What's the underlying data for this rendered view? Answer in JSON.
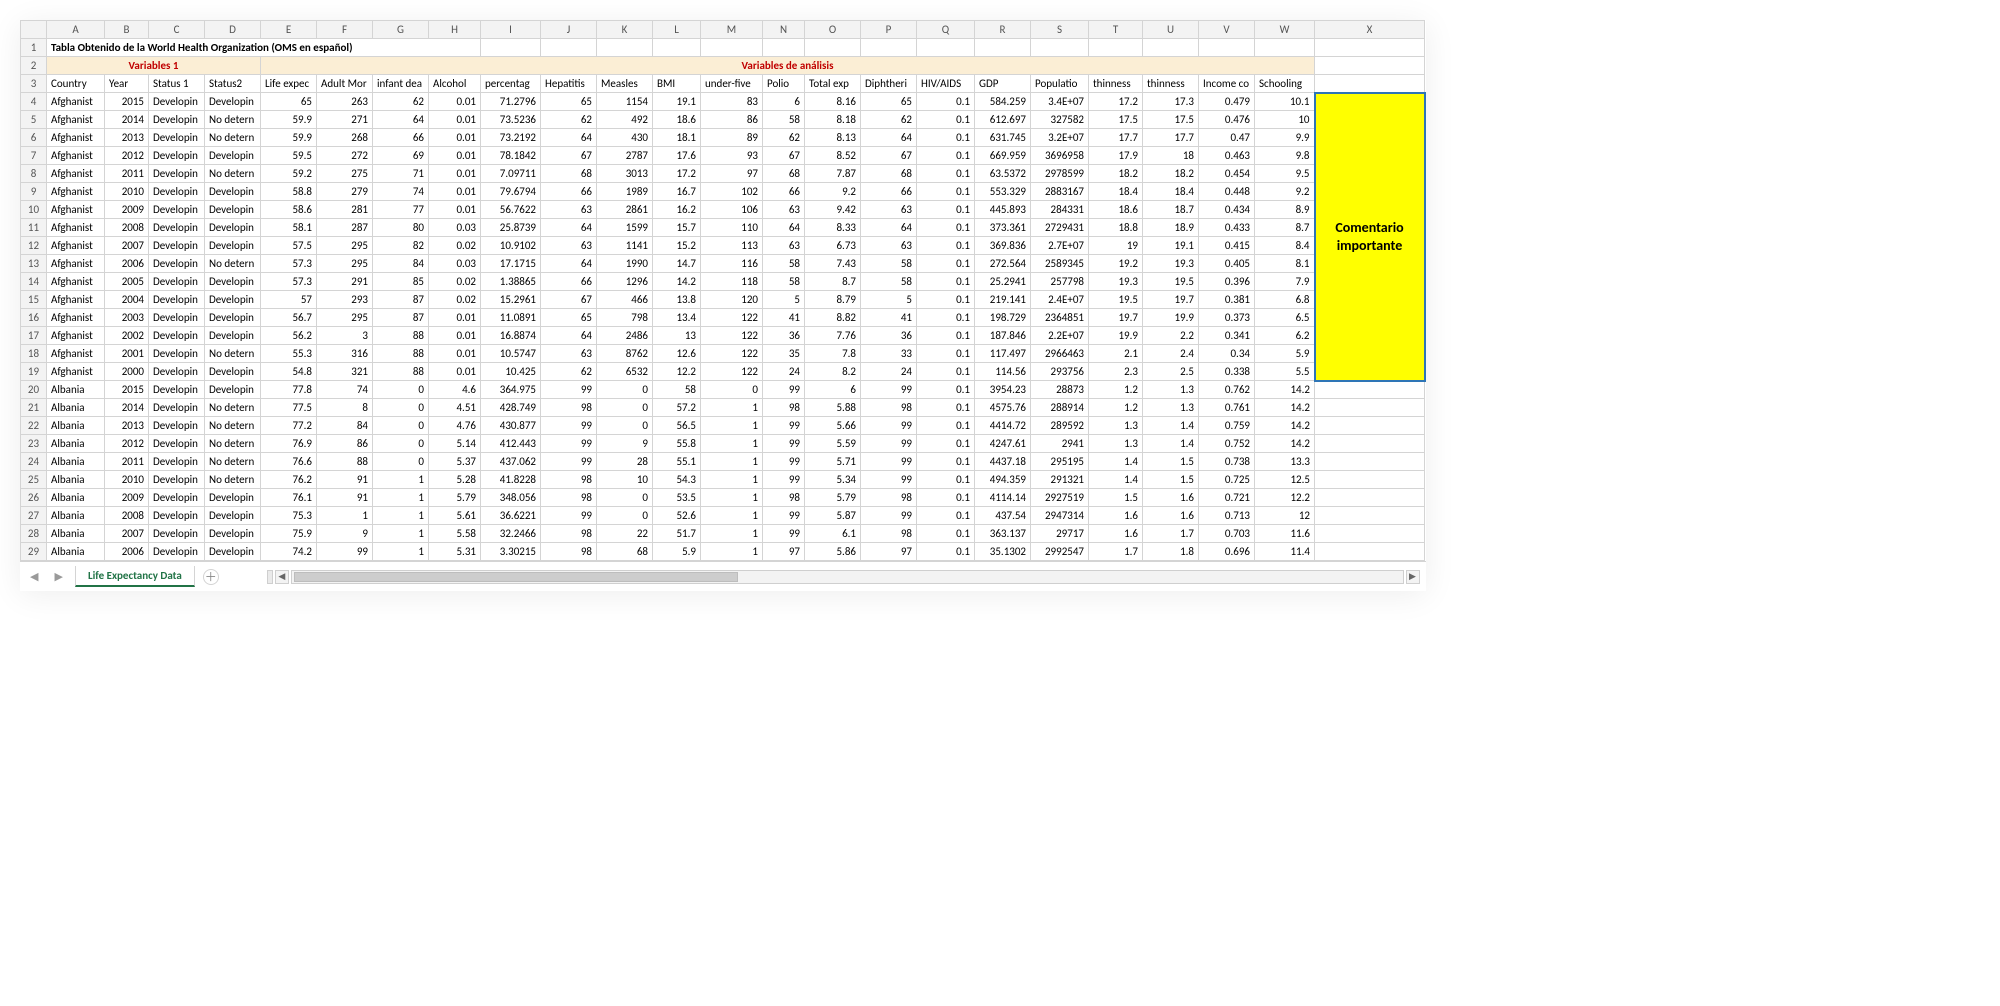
{
  "columns": [
    "A",
    "B",
    "C",
    "D",
    "E",
    "F",
    "G",
    "H",
    "I",
    "J",
    "K",
    "L",
    "M",
    "N",
    "O",
    "P",
    "Q",
    "R",
    "S",
    "T",
    "U",
    "V",
    "W",
    "X"
  ],
  "row1_title": "Tabla Obtenido de la World Health Organization (OMS en español)",
  "row2": {
    "variables1": "Variables 1",
    "variables_analisis": "Variables de análisis"
  },
  "headers": [
    "Country",
    "Year",
    "Status 1",
    "Status2",
    "Life expec",
    "Adult Mor",
    "infant dea",
    "Alcohol",
    "percentag",
    "Hepatitis ",
    "Measles",
    "BMI",
    "under-five",
    "Polio",
    "Total exp",
    "Diphtheri",
    "HIV/AIDS",
    "GDP",
    "Populatio",
    "thinness ",
    "thinness ",
    "Income co",
    "Schooling"
  ],
  "highlight_lines": [
    "Comentario",
    "importante"
  ],
  "sheet_tab": "Life Expectancy Data",
  "rows": [
    {
      "n": 4,
      "c": "Afghanist",
      "y": "2015",
      "s1": "Developin",
      "s2": "Developin",
      "v": [
        "65",
        "263",
        "62",
        "0.01",
        "71.2796",
        "65",
        "1154",
        "19.1",
        "83",
        "6",
        "8.16",
        "65",
        "0.1",
        "584.259",
        "3.4E+07",
        "17.2",
        "17.3",
        "0.479",
        "10.1"
      ]
    },
    {
      "n": 5,
      "c": "Afghanist",
      "y": "2014",
      "s1": "Developin",
      "s2": "No detern",
      "v": [
        "59.9",
        "271",
        "64",
        "0.01",
        "73.5236",
        "62",
        "492",
        "18.6",
        "86",
        "58",
        "8.18",
        "62",
        "0.1",
        "612.697",
        "327582",
        "17.5",
        "17.5",
        "0.476",
        "10"
      ]
    },
    {
      "n": 6,
      "c": "Afghanist",
      "y": "2013",
      "s1": "Developin",
      "s2": "No detern",
      "v": [
        "59.9",
        "268",
        "66",
        "0.01",
        "73.2192",
        "64",
        "430",
        "18.1",
        "89",
        "62",
        "8.13",
        "64",
        "0.1",
        "631.745",
        "3.2E+07",
        "17.7",
        "17.7",
        "0.47",
        "9.9"
      ]
    },
    {
      "n": 7,
      "c": "Afghanist",
      "y": "2012",
      "s1": "Developin",
      "s2": "Developin",
      "v": [
        "59.5",
        "272",
        "69",
        "0.01",
        "78.1842",
        "67",
        "2787",
        "17.6",
        "93",
        "67",
        "8.52",
        "67",
        "0.1",
        "669.959",
        "3696958",
        "17.9",
        "18",
        "0.463",
        "9.8"
      ]
    },
    {
      "n": 8,
      "c": "Afghanist",
      "y": "2011",
      "s1": "Developin",
      "s2": "No detern",
      "v": [
        "59.2",
        "275",
        "71",
        "0.01",
        "7.09711",
        "68",
        "3013",
        "17.2",
        "97",
        "68",
        "7.87",
        "68",
        "0.1",
        "63.5372",
        "2978599",
        "18.2",
        "18.2",
        "0.454",
        "9.5"
      ]
    },
    {
      "n": 9,
      "c": "Afghanist",
      "y": "2010",
      "s1": "Developin",
      "s2": "Developin",
      "v": [
        "58.8",
        "279",
        "74",
        "0.01",
        "79.6794",
        "66",
        "1989",
        "16.7",
        "102",
        "66",
        "9.2",
        "66",
        "0.1",
        "553.329",
        "2883167",
        "18.4",
        "18.4",
        "0.448",
        "9.2"
      ]
    },
    {
      "n": 10,
      "c": "Afghanist",
      "y": "2009",
      "s1": "Developin",
      "s2": "Developin",
      "v": [
        "58.6",
        "281",
        "77",
        "0.01",
        "56.7622",
        "63",
        "2861",
        "16.2",
        "106",
        "63",
        "9.42",
        "63",
        "0.1",
        "445.893",
        "284331",
        "18.6",
        "18.7",
        "0.434",
        "8.9"
      ]
    },
    {
      "n": 11,
      "c": "Afghanist",
      "y": "2008",
      "s1": "Developin",
      "s2": "Developin",
      "v": [
        "58.1",
        "287",
        "80",
        "0.03",
        "25.8739",
        "64",
        "1599",
        "15.7",
        "110",
        "64",
        "8.33",
        "64",
        "0.1",
        "373.361",
        "2729431",
        "18.8",
        "18.9",
        "0.433",
        "8.7"
      ]
    },
    {
      "n": 12,
      "c": "Afghanist",
      "y": "2007",
      "s1": "Developin",
      "s2": "Developin",
      "v": [
        "57.5",
        "295",
        "82",
        "0.02",
        "10.9102",
        "63",
        "1141",
        "15.2",
        "113",
        "63",
        "6.73",
        "63",
        "0.1",
        "369.836",
        "2.7E+07",
        "19",
        "19.1",
        "0.415",
        "8.4"
      ]
    },
    {
      "n": 13,
      "c": "Afghanist",
      "y": "2006",
      "s1": "Developin",
      "s2": "No detern",
      "v": [
        "57.3",
        "295",
        "84",
        "0.03",
        "17.1715",
        "64",
        "1990",
        "14.7",
        "116",
        "58",
        "7.43",
        "58",
        "0.1",
        "272.564",
        "2589345",
        "19.2",
        "19.3",
        "0.405",
        "8.1"
      ]
    },
    {
      "n": 14,
      "c": "Afghanist",
      "y": "2005",
      "s1": "Developin",
      "s2": "Developin",
      "v": [
        "57.3",
        "291",
        "85",
        "0.02",
        "1.38865",
        "66",
        "1296",
        "14.2",
        "118",
        "58",
        "8.7",
        "58",
        "0.1",
        "25.2941",
        "257798",
        "19.3",
        "19.5",
        "0.396",
        "7.9"
      ]
    },
    {
      "n": 15,
      "c": "Afghanist",
      "y": "2004",
      "s1": "Developin",
      "s2": "Developin",
      "v": [
        "57",
        "293",
        "87",
        "0.02",
        "15.2961",
        "67",
        "466",
        "13.8",
        "120",
        "5",
        "8.79",
        "5",
        "0.1",
        "219.141",
        "2.4E+07",
        "19.5",
        "19.7",
        "0.381",
        "6.8"
      ]
    },
    {
      "n": 16,
      "c": "Afghanist",
      "y": "2003",
      "s1": "Developin",
      "s2": "Developin",
      "v": [
        "56.7",
        "295",
        "87",
        "0.01",
        "11.0891",
        "65",
        "798",
        "13.4",
        "122",
        "41",
        "8.82",
        "41",
        "0.1",
        "198.729",
        "2364851",
        "19.7",
        "19.9",
        "0.373",
        "6.5"
      ]
    },
    {
      "n": 17,
      "c": "Afghanist",
      "y": "2002",
      "s1": "Developin",
      "s2": "Developin",
      "v": [
        "56.2",
        "3",
        "88",
        "0.01",
        "16.8874",
        "64",
        "2486",
        "13",
        "122",
        "36",
        "7.76",
        "36",
        "0.1",
        "187.846",
        "2.2E+07",
        "19.9",
        "2.2",
        "0.341",
        "6.2"
      ]
    },
    {
      "n": 18,
      "c": "Afghanist",
      "y": "2001",
      "s1": "Developin",
      "s2": "No detern",
      "v": [
        "55.3",
        "316",
        "88",
        "0.01",
        "10.5747",
        "63",
        "8762",
        "12.6",
        "122",
        "35",
        "7.8",
        "33",
        "0.1",
        "117.497",
        "2966463",
        "2.1",
        "2.4",
        "0.34",
        "5.9"
      ]
    },
    {
      "n": 19,
      "c": "Afghanist",
      "y": "2000",
      "s1": "Developin",
      "s2": "Developin",
      "v": [
        "54.8",
        "321",
        "88",
        "0.01",
        "10.425",
        "62",
        "6532",
        "12.2",
        "122",
        "24",
        "8.2",
        "24",
        "0.1",
        "114.56",
        "293756",
        "2.3",
        "2.5",
        "0.338",
        "5.5"
      ]
    },
    {
      "n": 20,
      "c": "Albania",
      "y": "2015",
      "s1": "Developin",
      "s2": "Developin",
      "v": [
        "77.8",
        "74",
        "0",
        "4.6",
        "364.975",
        "99",
        "0",
        "58",
        "0",
        "99",
        "6",
        "99",
        "0.1",
        "3954.23",
        "28873",
        "1.2",
        "1.3",
        "0.762",
        "14.2"
      ]
    },
    {
      "n": 21,
      "c": "Albania",
      "y": "2014",
      "s1": "Developin",
      "s2": "No detern",
      "v": [
        "77.5",
        "8",
        "0",
        "4.51",
        "428.749",
        "98",
        "0",
        "57.2",
        "1",
        "98",
        "5.88",
        "98",
        "0.1",
        "4575.76",
        "288914",
        "1.2",
        "1.3",
        "0.761",
        "14.2"
      ]
    },
    {
      "n": 22,
      "c": "Albania",
      "y": "2013",
      "s1": "Developin",
      "s2": "No detern",
      "v": [
        "77.2",
        "84",
        "0",
        "4.76",
        "430.877",
        "99",
        "0",
        "56.5",
        "1",
        "99",
        "5.66",
        "99",
        "0.1",
        "4414.72",
        "289592",
        "1.3",
        "1.4",
        "0.759",
        "14.2"
      ]
    },
    {
      "n": 23,
      "c": "Albania",
      "y": "2012",
      "s1": "Developin",
      "s2": "No detern",
      "v": [
        "76.9",
        "86",
        "0",
        "5.14",
        "412.443",
        "99",
        "9",
        "55.8",
        "1",
        "99",
        "5.59",
        "99",
        "0.1",
        "4247.61",
        "2941",
        "1.3",
        "1.4",
        "0.752",
        "14.2"
      ]
    },
    {
      "n": 24,
      "c": "Albania",
      "y": "2011",
      "s1": "Developin",
      "s2": "No detern",
      "v": [
        "76.6",
        "88",
        "0",
        "5.37",
        "437.062",
        "99",
        "28",
        "55.1",
        "1",
        "99",
        "5.71",
        "99",
        "0.1",
        "4437.18",
        "295195",
        "1.4",
        "1.5",
        "0.738",
        "13.3"
      ]
    },
    {
      "n": 25,
      "c": "Albania",
      "y": "2010",
      "s1": "Developin",
      "s2": "No detern",
      "v": [
        "76.2",
        "91",
        "1",
        "5.28",
        "41.8228",
        "98",
        "10",
        "54.3",
        "1",
        "99",
        "5.34",
        "99",
        "0.1",
        "494.359",
        "291321",
        "1.4",
        "1.5",
        "0.725",
        "12.5"
      ]
    },
    {
      "n": 26,
      "c": "Albania",
      "y": "2009",
      "s1": "Developin",
      "s2": "Developin",
      "v": [
        "76.1",
        "91",
        "1",
        "5.79",
        "348.056",
        "98",
        "0",
        "53.5",
        "1",
        "98",
        "5.79",
        "98",
        "0.1",
        "4114.14",
        "2927519",
        "1.5",
        "1.6",
        "0.721",
        "12.2"
      ]
    },
    {
      "n": 27,
      "c": "Albania",
      "y": "2008",
      "s1": "Developin",
      "s2": "Developin",
      "v": [
        "75.3",
        "1",
        "1",
        "5.61",
        "36.6221",
        "99",
        "0",
        "52.6",
        "1",
        "99",
        "5.87",
        "99",
        "0.1",
        "437.54",
        "2947314",
        "1.6",
        "1.6",
        "0.713",
        "12"
      ]
    },
    {
      "n": 28,
      "c": "Albania",
      "y": "2007",
      "s1": "Developin",
      "s2": "Developin",
      "v": [
        "75.9",
        "9",
        "1",
        "5.58",
        "32.2466",
        "98",
        "22",
        "51.7",
        "1",
        "99",
        "6.1",
        "98",
        "0.1",
        "363.137",
        "29717",
        "1.6",
        "1.7",
        "0.703",
        "11.6"
      ]
    },
    {
      "n": 29,
      "c": "Albania",
      "y": "2006",
      "s1": "Developin",
      "s2": "Developin",
      "v": [
        "74.2",
        "99",
        "1",
        "5.31",
        "3.30215",
        "98",
        "68",
        "5.9",
        "1",
        "97",
        "5.86",
        "97",
        "0.1",
        "35.1302",
        "2992547",
        "1.7",
        "1.8",
        "0.696",
        "11.4"
      ]
    }
  ]
}
